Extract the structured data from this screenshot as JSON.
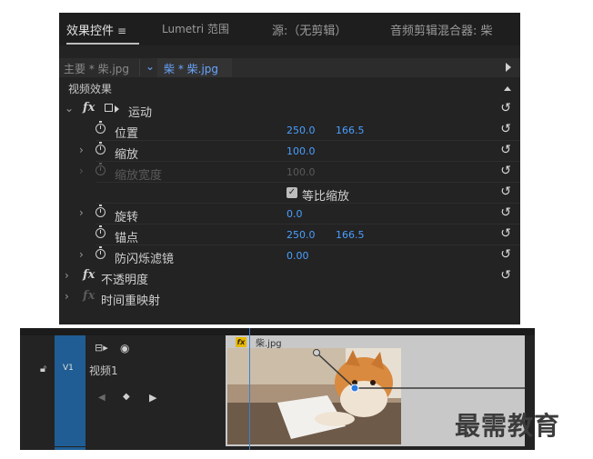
{
  "tabs": {
    "effect_controls": "效果控件",
    "effect_controls_menu": "≡",
    "lumetri": "Lumetri 范围",
    "source": "源:（无剪辑）",
    "audio_mixer": "音频剪辑混合器: 柴"
  },
  "clip_selector": {
    "master": "主要 * 柴.jpg",
    "sequence": "柴 * 柴.jpg"
  },
  "section_video": "视频效果",
  "effects": {
    "motion": {
      "label": "运动",
      "position": {
        "label": "位置",
        "x": "250.0",
        "y": "166.5"
      },
      "scale": {
        "label": "缩放",
        "value": "100.0"
      },
      "scale_width": {
        "label": "缩放宽度",
        "value": "100.0"
      },
      "uniform_scale": {
        "label": "等比缩放",
        "checked": true
      },
      "rotation": {
        "label": "旋转",
        "value": "0.0"
      },
      "anchor": {
        "label": "锚点",
        "x": "250.0",
        "y": "166.5"
      },
      "flicker": {
        "label": "防闪烁滤镜",
        "value": "0.00"
      }
    },
    "opacity": {
      "label": "不透明度"
    },
    "time_remap": {
      "label": "时间重映射"
    }
  },
  "timeline": {
    "track_target": "V1",
    "track_name": "视频1",
    "clip_name": "柴.jpg"
  },
  "watermark": "最需教育",
  "colors": {
    "accent_blue": "#4a9fff",
    "track_blue": "#1f5d94",
    "fx_badge": "#e6b800"
  }
}
